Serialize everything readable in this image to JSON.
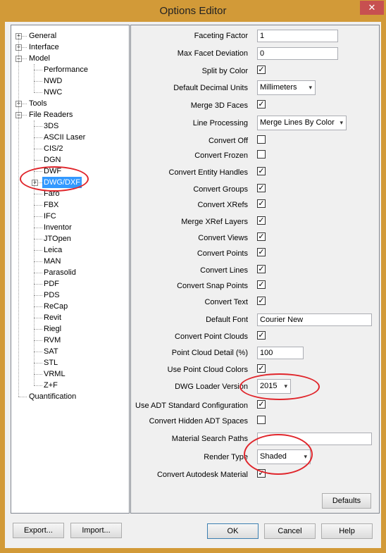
{
  "window": {
    "title": "Options Editor",
    "close_glyph": "✕"
  },
  "tree": {
    "top": [
      {
        "label": "General",
        "expander": "+"
      },
      {
        "label": "Interface",
        "expander": "+"
      },
      {
        "label": "Model",
        "expander": "−"
      },
      {
        "label": "Tools",
        "expander": "+"
      },
      {
        "label": "File Readers",
        "expander": "−"
      },
      {
        "label": "Quantification",
        "expander": ""
      }
    ],
    "model_children": [
      "Performance",
      "NWD",
      "NWC"
    ],
    "reader_children": [
      "3DS",
      "ASCII Laser",
      "CIS/2",
      "DGN",
      "DWF",
      "DWG/DXF",
      "Faro",
      "FBX",
      "IFC",
      "Inventor",
      "JTOpen",
      "Leica",
      "MAN",
      "Parasolid",
      "PDF",
      "PDS",
      "ReCap",
      "Revit",
      "Riegl",
      "RVM",
      "SAT",
      "STL",
      "VRML",
      "Z+F"
    ],
    "selected": "DWG/DXF"
  },
  "options": [
    {
      "label": "Faceting Factor",
      "type": "text",
      "value": "1"
    },
    {
      "label": "Max Facet Deviation",
      "type": "text",
      "value": "0"
    },
    {
      "label": "Split by Color",
      "type": "check",
      "checked": true
    },
    {
      "label": "Default Decimal Units",
      "type": "combo",
      "value": "Millimeters"
    },
    {
      "label": "Merge 3D Faces",
      "type": "check",
      "checked": true
    },
    {
      "label": "Line Processing",
      "type": "combo",
      "value": "Merge Lines By Color"
    },
    {
      "label": "Convert Off",
      "type": "check",
      "checked": false
    },
    {
      "label": "Convert Frozen",
      "type": "check",
      "checked": false
    },
    {
      "label": "Convert Entity Handles",
      "type": "check",
      "checked": true
    },
    {
      "label": "Convert Groups",
      "type": "check",
      "checked": true
    },
    {
      "label": "Convert XRefs",
      "type": "check",
      "checked": true
    },
    {
      "label": "Merge XRef Layers",
      "type": "check",
      "checked": true
    },
    {
      "label": "Convert Views",
      "type": "check",
      "checked": true
    },
    {
      "label": "Convert Points",
      "type": "check",
      "checked": true
    },
    {
      "label": "Convert Lines",
      "type": "check",
      "checked": true
    },
    {
      "label": "Convert Snap Points",
      "type": "check",
      "checked": true
    },
    {
      "label": "Convert Text",
      "type": "check",
      "checked": true
    },
    {
      "label": "Default Font",
      "type": "text",
      "value": "Courier New"
    },
    {
      "label": "Convert Point Clouds",
      "type": "check",
      "checked": true
    },
    {
      "label": "Point Cloud Detail (%)",
      "type": "text",
      "value": "100"
    },
    {
      "label": "Use Point Cloud Colors",
      "type": "check",
      "checked": true
    },
    {
      "label": "DWG Loader Version",
      "type": "combo",
      "value": "2015"
    },
    {
      "label": "Use ADT Standard Configuration",
      "type": "check",
      "checked": true
    },
    {
      "label": "Convert Hidden ADT Spaces",
      "type": "check",
      "checked": false
    },
    {
      "label": "Material Search Paths",
      "type": "text",
      "value": ""
    },
    {
      "label": "Render Type",
      "type": "combo",
      "value": "Shaded"
    },
    {
      "label": "Convert Autodesk Material",
      "type": "check",
      "checked": true
    }
  ],
  "checkmark": "✓",
  "combo_arrow": "▾",
  "buttons": {
    "defaults": "Defaults",
    "export": "Export...",
    "import": "Import...",
    "ok": "OK",
    "cancel": "Cancel",
    "help": "Help"
  },
  "annotation_color": "#e0252b"
}
